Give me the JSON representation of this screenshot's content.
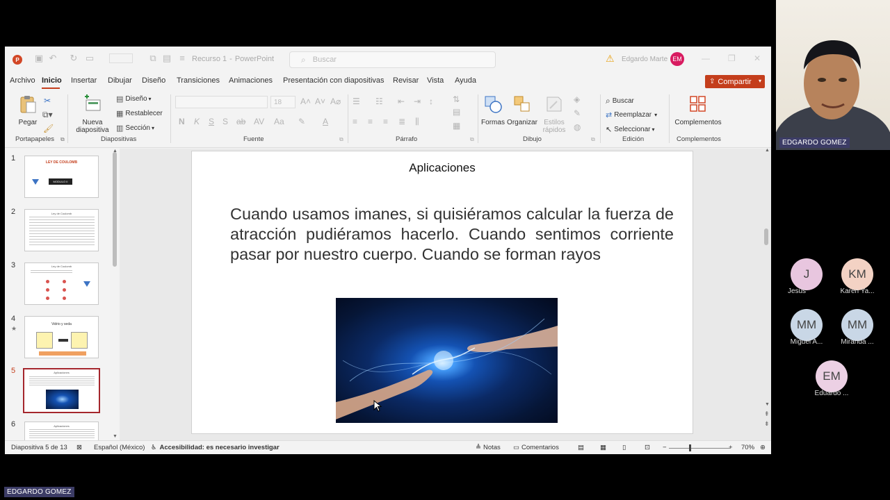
{
  "window": {
    "file_name": "Recurso 1",
    "separator": "-",
    "app_name": "PowerPoint",
    "search_placeholder": "Buscar",
    "user_name": "Edgardo Marte",
    "user_initials": "EM"
  },
  "menu": {
    "items": [
      "Archivo",
      "Inicio",
      "Insertar",
      "Dibujar",
      "Diseño",
      "Transiciones",
      "Animaciones",
      "Presentación con diapositivas",
      "Revisar",
      "Vista",
      "Ayuda"
    ],
    "active": "Inicio",
    "share_label": "Compartir"
  },
  "ribbon": {
    "portapapeles": {
      "paste": "Pegar",
      "label": "Portapapeles"
    },
    "diapositivas": {
      "new_slide_1": "Nueva",
      "new_slide_2": "diapositiva",
      "layout": "Diseño",
      "reset": "Restablecer",
      "section": "Sección",
      "label": "Diapositivas"
    },
    "fuente": {
      "size": "18",
      "label": "Fuente"
    },
    "parrafo": {
      "label": "Párrafo"
    },
    "dibujo": {
      "shapes": "Formas",
      "arrange": "Organizar",
      "styles_1": "Estilos",
      "styles_2": "rápidos",
      "label": "Dibujo"
    },
    "edicion": {
      "find": "Buscar",
      "replace": "Reemplazar",
      "select": "Seleccionar",
      "label": "Edición"
    },
    "complementos": {
      "addins": "Complementos",
      "label": "Complementos"
    }
  },
  "thumbnails": [
    {
      "num": "1",
      "title": "LEY DE COULOMB",
      "badge": "MODULO II"
    },
    {
      "num": "2",
      "title": "Ley de Coulomb"
    },
    {
      "num": "3",
      "title": "Ley de Coulomb"
    },
    {
      "num": "4",
      "title": "Vidrio y seda",
      "star": "★"
    },
    {
      "num": "5",
      "title": "Aplicaciones",
      "active": true
    },
    {
      "num": "6",
      "title": "Aplicaciones"
    }
  ],
  "slide": {
    "title": "Aplicaciones",
    "body": "Cuando usamos imanes, si quisiéramos calcular la fuerza de atracción pudiéramos hacerlo. Cuando sentimos corriente pasar por nuestro cuerpo. Cuando se forman rayos"
  },
  "status": {
    "slide_counter": "Diapositiva 5 de 13",
    "language": "Español (México)",
    "accessibility": "Accesibilidad: es necesario investigar",
    "notes": "Notas",
    "comments": "Comentarios",
    "zoom": "70%"
  },
  "meeting": {
    "presenter_label": "EDGARDO GOMEZ",
    "bottom_label": "EDGARDO GOMEZ",
    "participants": [
      {
        "initials": "J",
        "name": "Jesús",
        "color": "#e8c6df"
      },
      {
        "initials": "KM",
        "name": "Karen Ya...",
        "color": "#f3d2c4"
      },
      {
        "initials": "MM",
        "name": "Miguel A...",
        "color": "#c9d7e6"
      },
      {
        "initials": "MM",
        "name": "Miranda ...",
        "color": "#c9d7e6"
      },
      {
        "initials": "EM",
        "name": "Eduardo ...",
        "color": "#ecd0e4"
      }
    ]
  }
}
